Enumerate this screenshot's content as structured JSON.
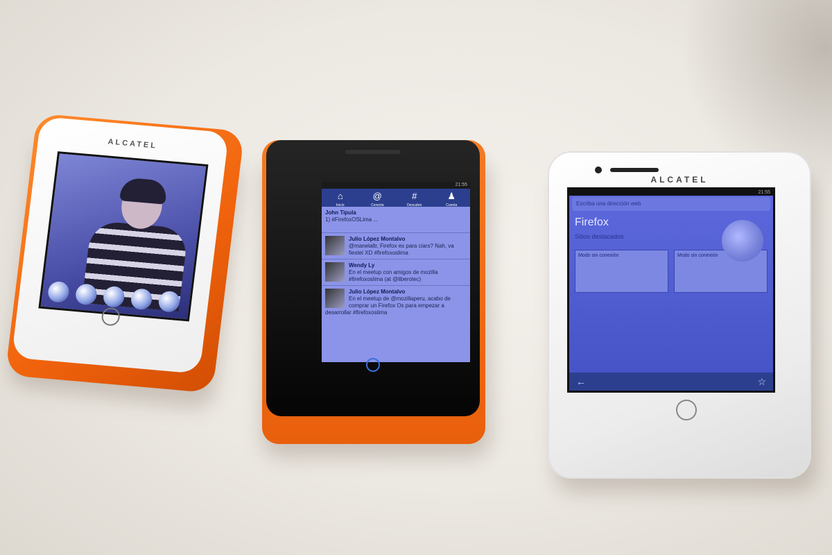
{
  "photo": {
    "phones": [
      {
        "brand": "ALCATEL",
        "screen": "lock screen photo"
      },
      {
        "status_time": "21:55",
        "nav": [
          "Inicio",
          "Conecta",
          "Descubre",
          "Cuenta"
        ],
        "tweets": [
          {
            "author": "John Tipula",
            "text": "1) #FirefoxOSLima ..."
          },
          {
            "author": "Julio López Montalvo",
            "text": "@manelaltr, Firefox es para ciars? Nah, va fiestel XD #firefoxoslima"
          },
          {
            "author": "Wendy Ly",
            "text": "En el meetup con amigos de mozilla #firefoxoslima (at @liberotec)"
          },
          {
            "author": "Julio López Montalvo",
            "text": "En el meetup de @mozillaperu, acabo de comprar un Firefox Os para empezar a desarrollar #firefoxoslima"
          }
        ]
      },
      {
        "brand": "ALCATEL",
        "status_time": "21:55",
        "url_placeholder": "Escriba una dirección web",
        "app_title": "Firefox",
        "section": "Sitios destacados",
        "tiles": [
          "Modo sin conexión",
          "Modo sin conexión"
        ],
        "bottom_back": "←",
        "bottom_star": "☆"
      }
    ]
  }
}
